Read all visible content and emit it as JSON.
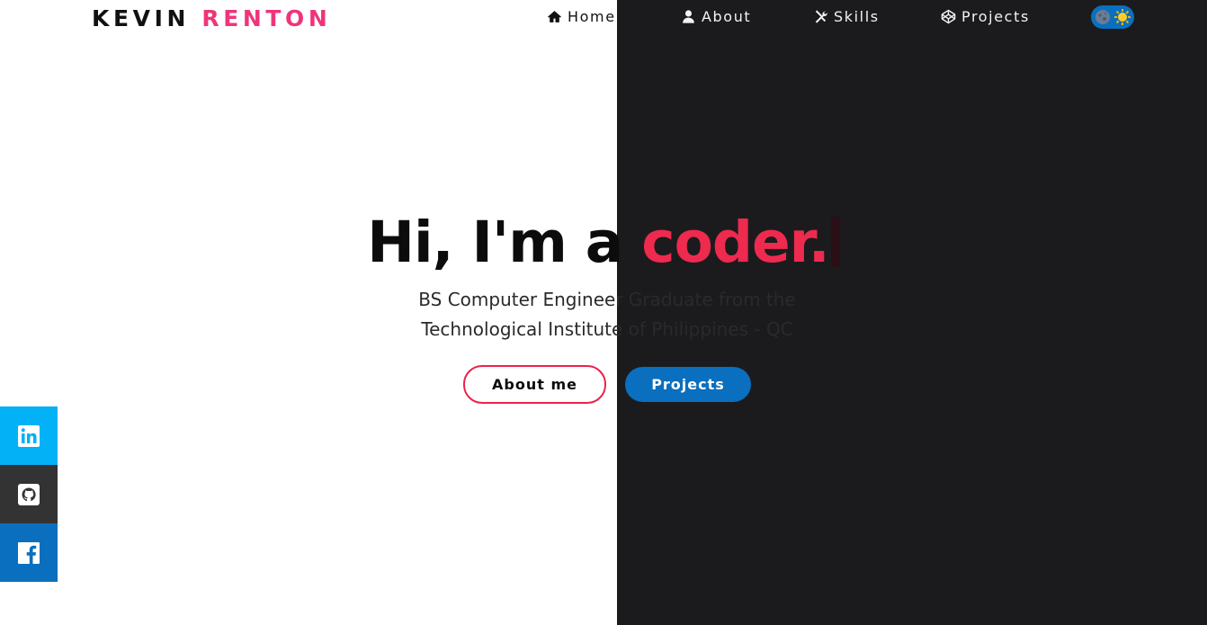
{
  "header": {
    "brand_first": "KEVIN",
    "brand_last": "RENTON",
    "nav": [
      {
        "label": "Home",
        "icon": "home-icon"
      },
      {
        "label": "About",
        "icon": "user-icon"
      },
      {
        "label": "Skills",
        "icon": "tools-icon"
      },
      {
        "label": "Projects",
        "icon": "codepen-icon"
      }
    ],
    "theme_toggle": {
      "icons": [
        "moon-icon",
        "sun-icon"
      ]
    }
  },
  "hero": {
    "title_intro": "Hi, I'm a ",
    "title_highlight": "coder.",
    "subtitle_line1": "BS Computer Engineer Graduate from the",
    "subtitle_line2": "Technological Institute of Philippines - QC",
    "btn_about": "About me",
    "btn_projects": "Projects"
  },
  "social": [
    {
      "name": "linkedin",
      "icon": "linkedin-icon",
      "color": "#02b1f6"
    },
    {
      "name": "github",
      "icon": "github-icon",
      "color": "#333333"
    },
    {
      "name": "facebook",
      "icon": "facebook-icon",
      "color": "#0a6fbe"
    }
  ],
  "colors": {
    "brand_accent": "#f0347a",
    "highlight": "#ee2a4f",
    "primary_blue": "#0a6fbe",
    "dark_bg": "#1b1b1d"
  }
}
